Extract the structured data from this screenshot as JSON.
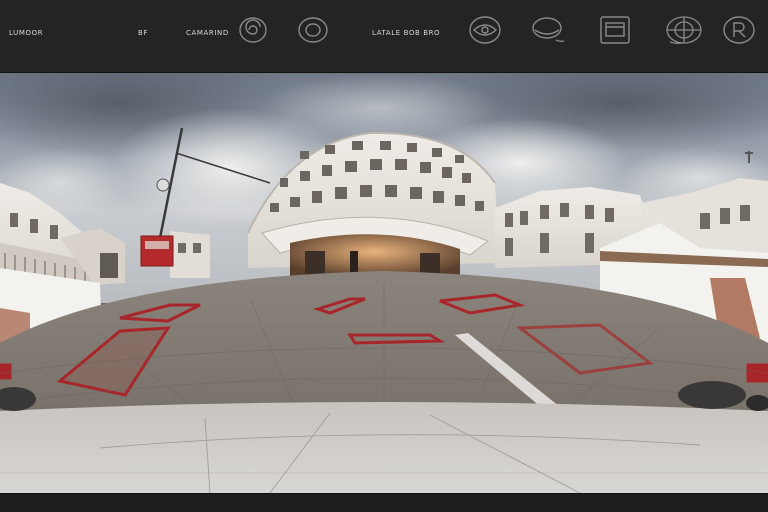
{
  "toolbar": {
    "left_label": "LUMOOR",
    "menu_short": "BF",
    "menu_mid": "CAMARIND",
    "center_label": "LATALE BOB BRO",
    "icons": [
      "spiral-icon",
      "circle-icon",
      "eye-icon",
      "disk-icon",
      "frame-icon",
      "globe-icon",
      "r-badge-icon"
    ]
  },
  "scene": {
    "sign_text": "",
    "description_colors": {
      "sky": "#8e98a6",
      "building": "#e9e6e1",
      "pavement": "#7d7770",
      "accent_red": "#a8262a"
    }
  }
}
